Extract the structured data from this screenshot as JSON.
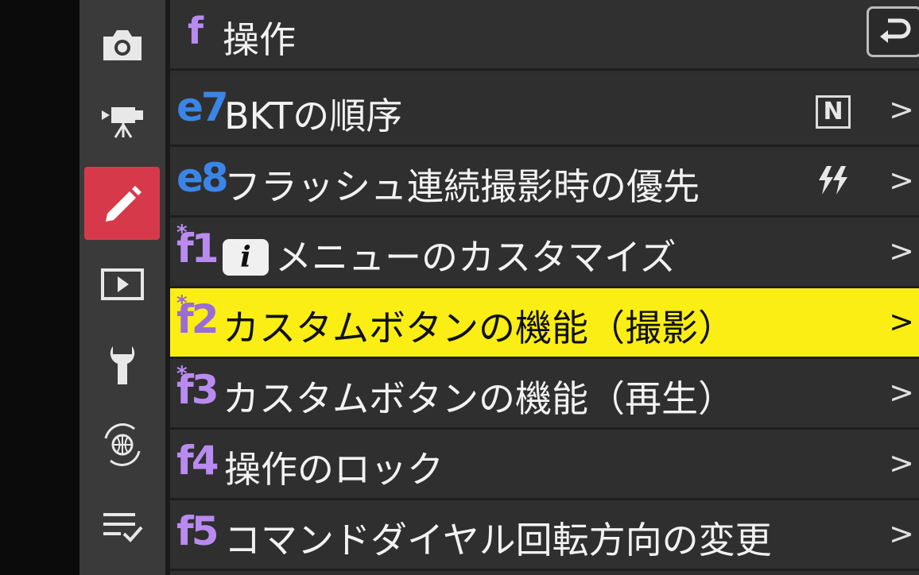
{
  "sidebar": {
    "items": [
      {
        "name": "camera-icon",
        "active": false
      },
      {
        "name": "movie-camera-icon",
        "active": false
      },
      {
        "name": "pencil-icon",
        "active": true
      },
      {
        "name": "playback-icon",
        "active": false
      },
      {
        "name": "wrench-icon",
        "active": false
      },
      {
        "name": "network-icon",
        "active": false
      },
      {
        "name": "my-menu-icon",
        "active": false
      }
    ]
  },
  "header": {
    "code": "f",
    "title": "操作",
    "back_icon": "return-icon"
  },
  "menu": {
    "rows": [
      {
        "code": "e7",
        "label": "BKTの順序",
        "value": "N",
        "value_icon": "n-bracket-icon",
        "arrow": ">",
        "selected": false
      },
      {
        "code": "e8",
        "label": "フラッシュ連続撮影時の優先",
        "value": "",
        "value_icon": "flash-burst-icon",
        "arrow": ">",
        "selected": false
      },
      {
        "code": "f1",
        "star": "*",
        "icon_text": "i",
        "label": "メニューのカスタマイズ",
        "arrow": ">",
        "selected": false
      },
      {
        "code": "f2",
        "star": "*",
        "label": "カスタムボタンの機能（撮影）",
        "arrow": ">",
        "selected": true
      },
      {
        "code": "f3",
        "star": "*",
        "label": "カスタムボタンの機能（再生）",
        "arrow": ">",
        "selected": false
      },
      {
        "code": "f4",
        "label": "操作のロック",
        "arrow": ">",
        "selected": false
      },
      {
        "code": "f5",
        "label": "コマンドダイヤル回転方向の変更",
        "arrow": ">",
        "selected": false
      }
    ]
  },
  "colors": {
    "selected_bg": "#fbee14",
    "sidebar_active": "#d63a4a",
    "code_e": "#3a86e8",
    "code_f": "#b98bf0"
  }
}
